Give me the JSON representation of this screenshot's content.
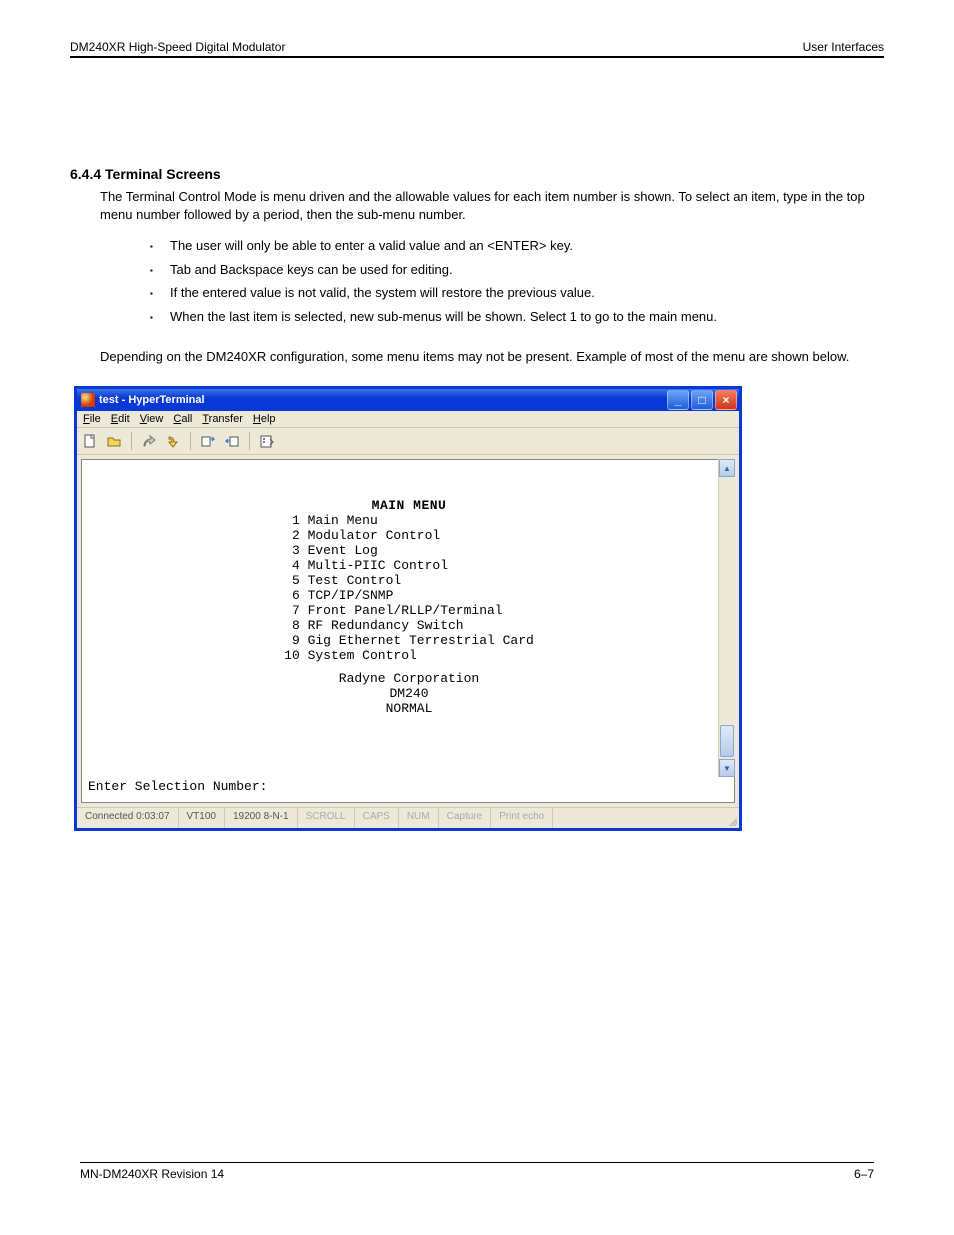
{
  "page": {
    "header_left": "DM240XR High-Speed Digital Modulator",
    "header_right": "User Interfaces",
    "footer_left": "MN-DM240XR  Revision 14",
    "footer_right": "6–7"
  },
  "section": {
    "num_title": "6.4.4 Terminal Screens",
    "intro": "The Terminal Control Mode is menu driven and the allowable values for each item number is shown. To select an item, type in the top menu number followed by a period, then the sub-menu number.",
    "bullets": [
      "The user will only be able to enter a valid value and an <ENTER> key.",
      "Tab and Backspace keys can be used for editing.",
      "If the entered value is not valid, the system will restore the previous value.",
      "When the last item is selected, new sub-menus will be shown. Select 1 to go to the main menu."
    ],
    "p2": "Depending on the DM240XR configuration, some menu items may not be present. Example of most of the menu are shown below."
  },
  "window": {
    "title": "test - HyperTerminal",
    "menus": {
      "file": "File",
      "edit": "Edit",
      "view": "View",
      "call": "Call",
      "transfer": "Transfer",
      "help": "Help"
    },
    "terminal": {
      "title": "MAIN MENU",
      "items": [
        " 1 Main Menu",
        " 2 Modulator Control",
        " 3 Event Log",
        " 4 Multi-PIIC Control",
        " 5 Test Control",
        " 6 TCP/IP/SNMP",
        " 7 Front Panel/RLLP/Terminal",
        " 8 RF Redundancy Switch",
        " 9 Gig Ethernet Terrestrial Card",
        "10 System Control"
      ],
      "footer_lines": [
        "Radyne Corporation",
        "DM240",
        "NORMAL"
      ],
      "prompt": "Enter Selection Number:"
    },
    "status": {
      "conn": "Connected 0:03:07",
      "emul": "VT100",
      "cfg": "19200 8-N-1",
      "f1": "SCROLL",
      "f2": "CAPS",
      "f3": "NUM",
      "f4": "Capture",
      "f5": "Print echo"
    }
  }
}
